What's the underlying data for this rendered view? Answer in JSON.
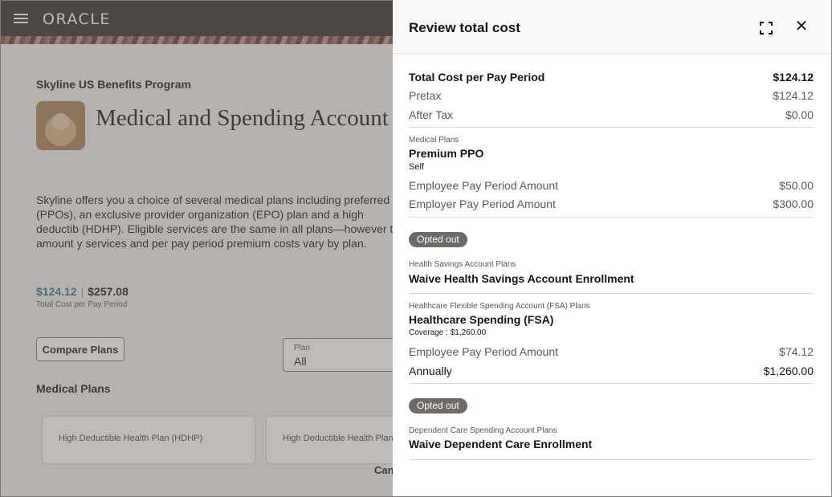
{
  "header": {
    "logo_text": "ORACLE"
  },
  "background": {
    "program": "Skyline US Benefits Program",
    "page_title": "Medical and Spending Account",
    "intro": "Skyline offers you a choice of several medical plans including preferred pr (PPOs), an exclusive provider organization (EPO) plan and a high deductib (HDHP). Eligible services are the same in all plans—however the amount y services and per pay period premium costs vary by plan.",
    "cost_selected": "$124.12",
    "cost_total": "$257.08",
    "cost_sub": "Total Cost per Pay Period",
    "compare_button": "Compare Plans",
    "plan_select_label": "Plan",
    "plan_select_value": "All",
    "medical_plans_title": "Medical Plans",
    "plan_cards": [
      "High Deductible Health Plan (HDHP)",
      "High Deductible Health Plan (H"
    ],
    "cancel_link": "Canc"
  },
  "drawer": {
    "title": "Review total cost",
    "summary": {
      "total_label": "Total Cost per Pay Period",
      "total_value": "$124.12",
      "pretax_label": "Pretax",
      "pretax_value": "$124.12",
      "aftertax_label": "After Tax",
      "aftertax_value": "$0.00"
    },
    "sections": [
      {
        "category": "Medical Plans",
        "plan": "Premium PPO",
        "sub": "Self",
        "rows": [
          {
            "label": "Employee Pay Period Amount",
            "value": "$50.00"
          },
          {
            "label": "Employer Pay Period Amount",
            "value": "$300.00"
          }
        ]
      },
      {
        "badge": "Opted out",
        "category": "Health Savings Account Plans",
        "plan": "Waive Health Savings Account Enrollment"
      },
      {
        "category": "Healthcare Flexible Spending Account (FSA) Plans",
        "plan": "Healthcare Spending (FSA)",
        "sub": "Coverage : $1,260.00",
        "rows": [
          {
            "label": "Employee Pay Period Amount",
            "value": "$74.12"
          },
          {
            "label": "Annually",
            "value": "$1,260.00"
          }
        ]
      },
      {
        "badge": "Opted out",
        "category": "Dependent Care Spending Account Plans",
        "plan": "Waive Dependent Care Enrollment"
      }
    ]
  }
}
